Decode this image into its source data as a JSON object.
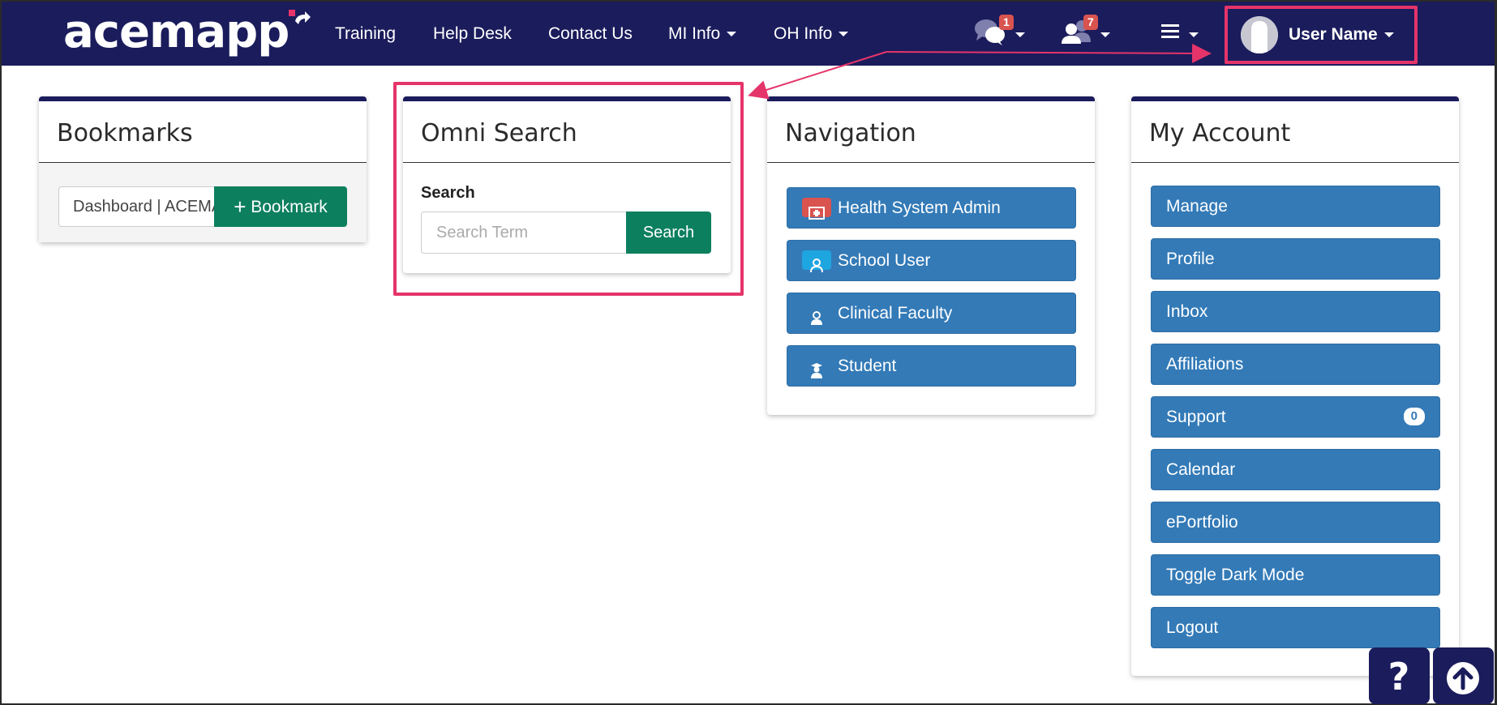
{
  "brand": {
    "logo_text": "acemapp"
  },
  "nav": {
    "links": [
      {
        "label": "Training"
      },
      {
        "label": "Help Desk"
      },
      {
        "label": "Contact Us"
      },
      {
        "label": "MI Info"
      },
      {
        "label": "OH Info"
      }
    ],
    "messages_badge": "1",
    "requests_badge": "7",
    "user_name": "User Name"
  },
  "bookmarks": {
    "title": "Bookmarks",
    "input_value": "Dashboard | ACEMAPP",
    "button_label": "Bookmark"
  },
  "omni_search": {
    "title": "Omni Search",
    "label": "Search",
    "placeholder": "Search Term",
    "button_label": "Search"
  },
  "navigation": {
    "title": "Navigation",
    "items": [
      {
        "label": "Health System Admin",
        "icon": "hospital-icon"
      },
      {
        "label": "School User",
        "icon": "user-icon"
      },
      {
        "label": "Clinical Faculty",
        "icon": "faculty-icon"
      },
      {
        "label": "Student",
        "icon": "student-icon"
      }
    ]
  },
  "my_account": {
    "title": "My Account",
    "items": [
      {
        "label": "Manage"
      },
      {
        "label": "Profile"
      },
      {
        "label": "Inbox"
      },
      {
        "label": "Affiliations"
      },
      {
        "label": "Support",
        "badge": "0"
      },
      {
        "label": "Calendar"
      },
      {
        "label": "ePortfolio"
      },
      {
        "label": "Toggle Dark Mode"
      },
      {
        "label": "Logout"
      }
    ]
  },
  "colors": {
    "navbar": "#1b1c5c",
    "primary_button": "#337ab7",
    "success_button": "#0c7f5e",
    "highlight": "#e5346a",
    "badge": "#d9534f"
  }
}
